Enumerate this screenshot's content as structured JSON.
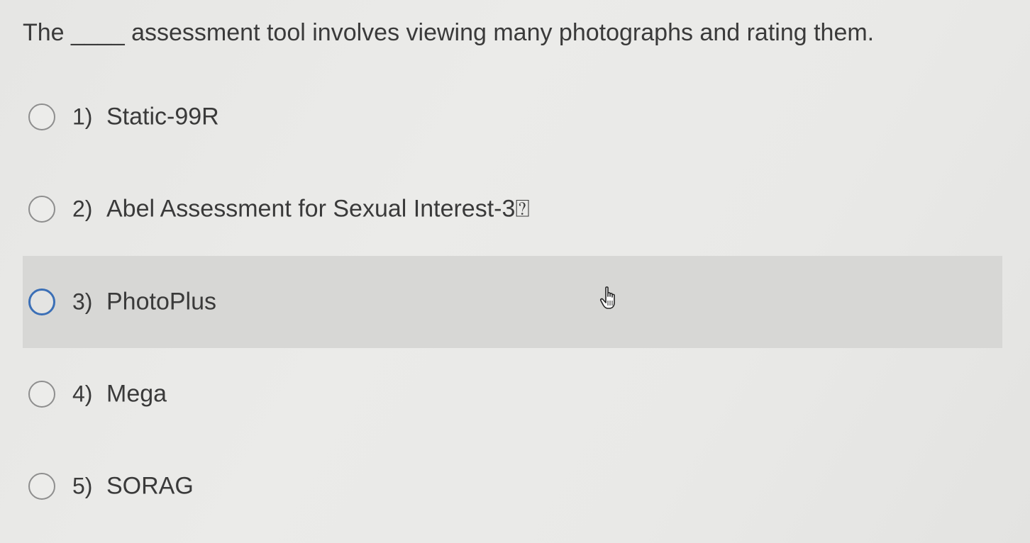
{
  "question": {
    "text": "The ____ assessment tool involves viewing many photographs and rating them."
  },
  "options": [
    {
      "number": "1)",
      "label": "Static-99R",
      "selected": false,
      "hovered": false
    },
    {
      "number": "2)",
      "label": "Abel Assessment for Sexual Interest-3⍰",
      "selected": false,
      "hovered": false
    },
    {
      "number": "3)",
      "label": "PhotoPlus",
      "selected": false,
      "hovered": true
    },
    {
      "number": "4)",
      "label": "Mega",
      "selected": false,
      "hovered": false
    },
    {
      "number": "5)",
      "label": "SORAG",
      "selected": false,
      "hovered": false
    }
  ],
  "colors": {
    "hover_row": "#d7d7d5",
    "radio_focus": "#3b6fb6",
    "text": "#3a3a3a"
  },
  "cursor": {
    "icon": "hand-pointer-icon"
  }
}
